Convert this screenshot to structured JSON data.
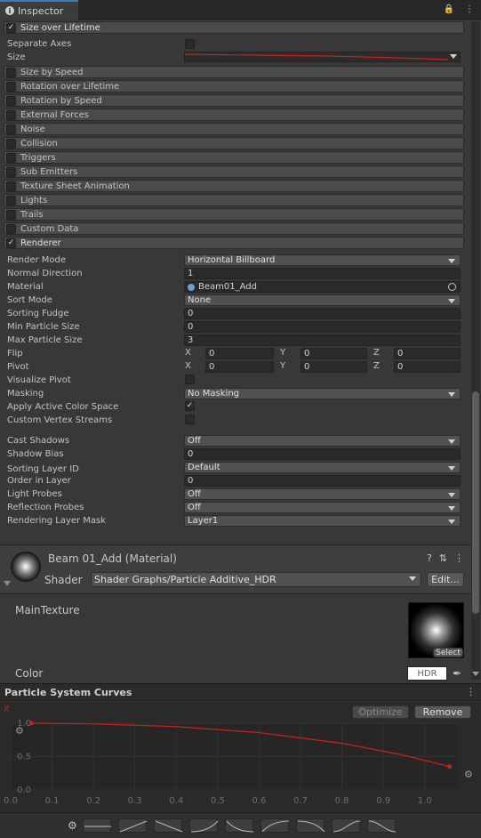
{
  "window": {
    "tab_title": "Inspector"
  },
  "size_over_lifetime": {
    "title": "Size over Lifetime",
    "enabled": true,
    "separate_axes_label": "Separate Axes",
    "size_label": "Size"
  },
  "modules": [
    {
      "label": "Size by Speed",
      "enabled": false
    },
    {
      "label": "Rotation over Lifetime",
      "enabled": false
    },
    {
      "label": "Rotation by Speed",
      "enabled": false
    },
    {
      "label": "External Forces",
      "enabled": false
    },
    {
      "label": "Noise",
      "enabled": false
    },
    {
      "label": "Collision",
      "enabled": false
    },
    {
      "label": "Triggers",
      "enabled": false
    },
    {
      "label": "Sub Emitters",
      "enabled": false
    },
    {
      "label": "Texture Sheet Animation",
      "enabled": false
    },
    {
      "label": "Lights",
      "enabled": false
    },
    {
      "label": "Trails",
      "enabled": false
    },
    {
      "label": "Custom Data",
      "enabled": false
    }
  ],
  "renderer": {
    "title": "Renderer",
    "enabled": true,
    "render_mode": {
      "label": "Render Mode",
      "value": "Horizontal Billboard"
    },
    "normal_direction": {
      "label": "Normal Direction",
      "value": "1"
    },
    "material": {
      "label": "Material",
      "value": "Beam01_Add"
    },
    "sort_mode": {
      "label": "Sort Mode",
      "value": "None"
    },
    "sorting_fudge": {
      "label": "Sorting Fudge",
      "value": "0"
    },
    "min_particle_size": {
      "label": "Min Particle Size",
      "value": "0"
    },
    "max_particle_size": {
      "label": "Max Particle Size",
      "value": "3"
    },
    "flip": {
      "label": "Flip",
      "x": "0",
      "y": "0",
      "z": "0"
    },
    "pivot": {
      "label": "Pivot",
      "x": "0",
      "y": "0",
      "z": "0"
    },
    "axis_x": "X",
    "axis_y": "Y",
    "axis_z": "Z",
    "visualize_pivot": {
      "label": "Visualize Pivot",
      "checked": false
    },
    "masking": {
      "label": "Masking",
      "value": "No Masking"
    },
    "apply_active_color_space": {
      "label": "Apply Active Color Space",
      "checked": true
    },
    "custom_vertex_streams": {
      "label": "Custom Vertex Streams",
      "checked": false
    },
    "cast_shadows": {
      "label": "Cast Shadows",
      "value": "Off"
    },
    "shadow_bias": {
      "label": "Shadow Bias",
      "value": "0"
    },
    "sorting_layer_id": {
      "label": "Sorting Layer ID",
      "value": "Default"
    },
    "order_in_layer": {
      "label": "Order in Layer",
      "value": "0"
    },
    "light_probes": {
      "label": "Light Probes",
      "value": "Off"
    },
    "reflection_probes": {
      "label": "Reflection Probes",
      "value": "Off"
    },
    "rendering_layer_mask": {
      "label": "Rendering Layer Mask",
      "value": "Layer1"
    }
  },
  "material_panel": {
    "title": "Beam 01_Add (Material)",
    "shader_label": "Shader",
    "shader_value": "Shader Graphs/Particle Additive_HDR",
    "edit_button": "Edit...",
    "main_texture_label": "MainTexture",
    "select_button": "Select",
    "color_label": "Color",
    "hdr_label": "HDR"
  },
  "curves": {
    "title": "Particle System Curves",
    "channel_label": "X",
    "optimize_button": "Optimize",
    "remove_button": "Remove",
    "curve_color": "#cc1e1e",
    "chart_data": {
      "type": "line",
      "y_ticks": [
        "1.0",
        "0.5",
        "0.0"
      ],
      "x_ticks": [
        "0.0",
        "0.1",
        "0.2",
        "0.3",
        "0.4",
        "0.5",
        "0.6",
        "0.7",
        "0.8",
        "0.9",
        "1.0"
      ],
      "xlim": [
        0,
        1.08
      ],
      "ylim": [
        0,
        1.0
      ],
      "series": [
        {
          "x": [
            0.05,
            0.2,
            0.4,
            0.6,
            0.8,
            0.95,
            1.06
          ],
          "y": [
            1.0,
            0.99,
            0.95,
            0.86,
            0.7,
            0.52,
            0.35
          ]
        }
      ]
    }
  }
}
